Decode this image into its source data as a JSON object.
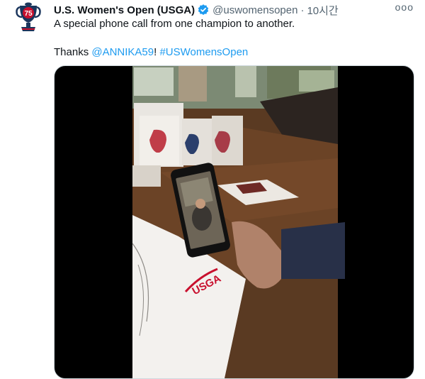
{
  "tweet": {
    "display_name": "U.S. Women's Open (USGA)",
    "handle": "@uswomensopen",
    "separator": "·",
    "time": "10시간",
    "more": "ooo",
    "text_line1": "A special phone call from one champion to another.",
    "thanks_prefix": "Thanks ",
    "mention": "@ANNIKA59",
    "exclaim": "! ",
    "hashtag": "#USWomensOpen"
  },
  "media": {
    "type": "video",
    "usga_mark": "USGA"
  },
  "colors": {
    "link": "#1d9bf0",
    "verified": "#1d9bf0",
    "logo_red": "#c8102e",
    "logo_blue": "#1b365d",
    "muted": "#536471"
  },
  "icons": {
    "avatar": "trophy-logo-75-icon",
    "verified": "verified-badge-icon",
    "more": "more-options-icon"
  }
}
